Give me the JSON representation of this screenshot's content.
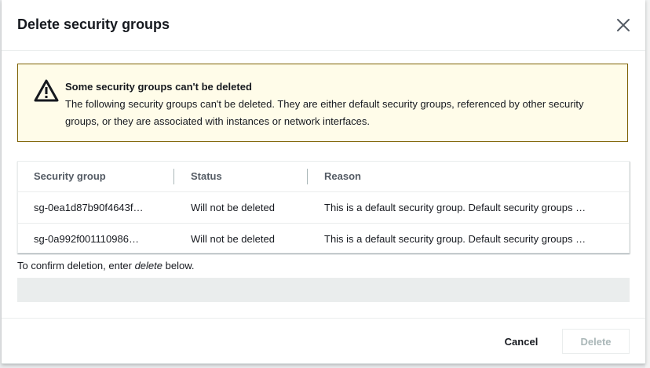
{
  "modal": {
    "title": "Delete security groups"
  },
  "alert": {
    "title": "Some security groups can't be deleted",
    "body": "The following security groups can't be deleted. They are either default security groups, referenced by other security groups, or they are associated with instances or network interfaces."
  },
  "table": {
    "columns": [
      "Security group",
      "Status",
      "Reason"
    ],
    "rows": [
      {
        "security_group": "sg-0ea1d87b90f4643f…",
        "status": "Will not be deleted",
        "reason": "This is a default security group. Default security groups …"
      },
      {
        "security_group": "sg-0a992f001110986…",
        "status": "Will not be deleted",
        "reason": "This is a default security group. Default security groups …"
      }
    ]
  },
  "confirm": {
    "prefix": "To confirm deletion, enter ",
    "keyword": "delete",
    "suffix": " below.",
    "input_value": ""
  },
  "footer": {
    "cancel_label": "Cancel",
    "delete_label": "Delete"
  },
  "icons": {
    "close": "close-icon",
    "warning": "warning-icon"
  },
  "colors": {
    "alert_background": "#fffce9",
    "alert_border": "#7d6102",
    "disabled_text": "#aab7b8"
  }
}
